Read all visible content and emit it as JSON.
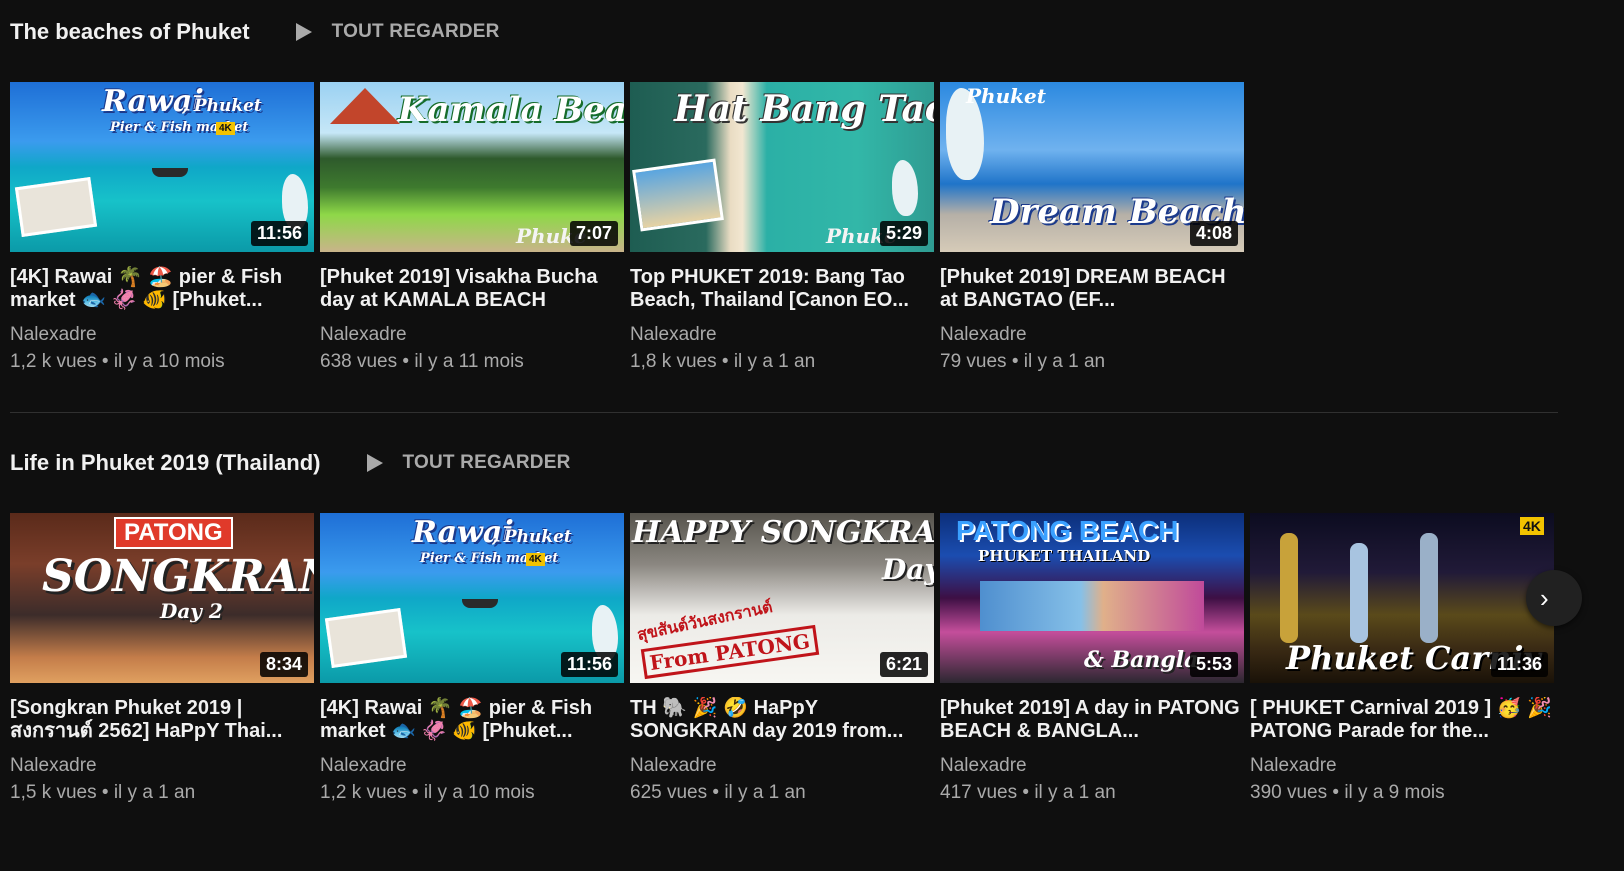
{
  "shelves": [
    {
      "title": "The beaches of Phuket",
      "play_all": "TOUT REGARDER",
      "videos": [
        {
          "title": "[4K] Rawai 🌴 🏖️ pier & Fish market 🐟 🦑 🐠 [Phuket...",
          "channel": "Nalexadre",
          "views_age": "1,2 k vues • il y a 10 mois",
          "duration": "11:56",
          "thumb_text": "Rawai",
          "thumb_text2": ", Phuket",
          "thumb_sub": "Pier & Fish market"
        },
        {
          "title": "[Phuket 2019] Visakha Bucha day at KAMALA BEACH",
          "channel": "Nalexadre",
          "views_age": "638 vues • il y a 11 mois",
          "duration": "7:07",
          "thumb_text": "Kamala Beach",
          "thumb_sub": "Phuke"
        },
        {
          "title": "Top PHUKET 2019: Bang Tao Beach, Thailand [Canon EO...",
          "channel": "Nalexadre",
          "views_age": "1,8 k vues • il y a 1 an",
          "duration": "5:29",
          "thumb_text": "Hat Bang Tao",
          "thumb_sub": "Phuke"
        },
        {
          "title": "[Phuket 2019] DREAM BEACH at BANGTAO (EF...",
          "channel": "Nalexadre",
          "views_age": "79 vues • il y a 1 an",
          "duration": "4:08",
          "thumb_text": "Dream Beach",
          "thumb_sub": "Phuket"
        }
      ]
    },
    {
      "title": "Life in Phuket 2019 (Thailand)",
      "play_all": "TOUT REGARDER",
      "videos": [
        {
          "title": "[Songkran Phuket 2019 | สงกรานต์ 2562] HaPpY Thai...",
          "channel": "Nalexadre",
          "views_age": "1,5 k vues • il y a 1 an",
          "duration": "8:34",
          "thumb_text": "SONGKRAN",
          "thumb_sub": "PATONG",
          "thumb_sub2": "Day 2"
        },
        {
          "title": "[4K] Rawai 🌴 🏖️ pier & Fish market 🐟 🦑 🐠 [Phuket...",
          "channel": "Nalexadre",
          "views_age": "1,2 k vues • il y a 10 mois",
          "duration": "11:56",
          "thumb_text": "Rawai",
          "thumb_text2": ", Phuket",
          "thumb_sub": "Pier & Fish market"
        },
        {
          "title": "TH 🐘 🎉 🤣 HaPpY SONGKRAN day 2019 from...",
          "channel": "Nalexadre",
          "views_age": "625 vues • il y a 1 an",
          "duration": "6:21",
          "thumb_text": "HAPPY SONGKRAN",
          "thumb_sub": "Day",
          "thumb_sub2": "From PATONG",
          "thumb_thai": "สุขสันต์วันสงกรานต์"
        },
        {
          "title": "[Phuket 2019] A day in PATONG BEACH & BANGLA...",
          "channel": "Nalexadre",
          "views_age": "417 vues • il y a 1 an",
          "duration": "5:53",
          "thumb_text": "PATONG BEACH",
          "thumb_sub": "PHUKET THAILAND",
          "thumb_sub2": "& Bangla"
        },
        {
          "title": "[ PHUKET Carnival 2019 ] 🥳 🎉 PATONG Parade for the...",
          "channel": "Nalexadre",
          "views_age": "390 vues • il y a 9 mois",
          "duration": "11:36",
          "thumb_text": "Phuket Carniv"
        }
      ]
    }
  ],
  "badge_4k": "4K",
  "next_glyph": "›",
  "colors": {
    "background": "#0f0f0f",
    "text_primary": "#f1f1f1",
    "text_secondary": "#aaaaaa"
  }
}
